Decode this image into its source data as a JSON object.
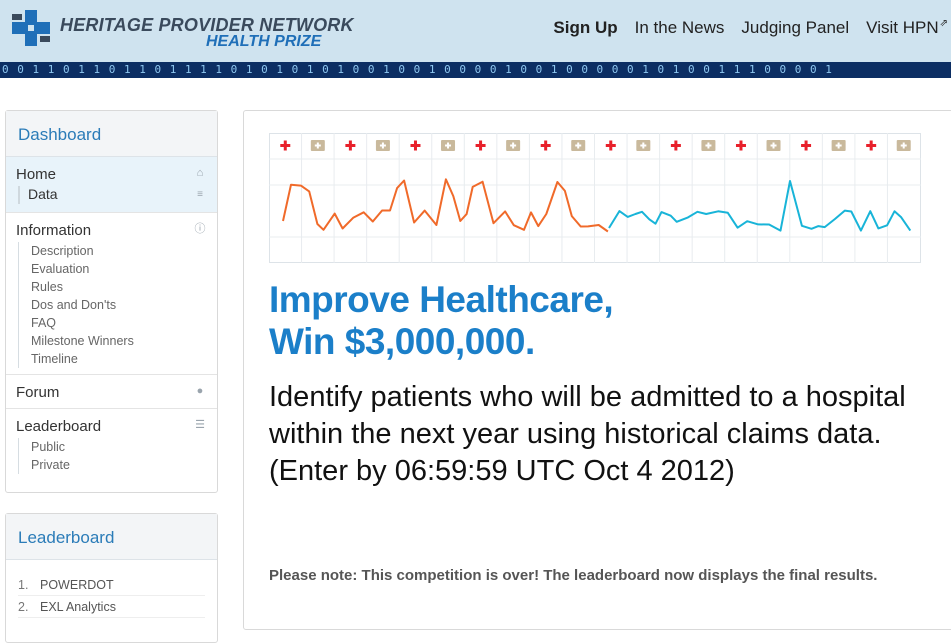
{
  "brand": {
    "line1": "HERITAGE PROVIDER NETWORK",
    "line2": "HEALTH PRIZE",
    "colors": {
      "navy": "#3a4a5c",
      "blue": "#1f6fb8",
      "header_bg": "#cfe3ef"
    }
  },
  "topnav": {
    "items": [
      {
        "label": "Sign Up"
      },
      {
        "label": "In the News"
      },
      {
        "label": "Judging Panel"
      },
      {
        "label": "Visit HPN"
      }
    ]
  },
  "binary_strip": "0 0 1  1 0   1 1 0  1  1 0   1 1  1 1 0  1 0   1 0   1 0  1 0 0  1 0 0 1  0 0 0  0  1 0 0  1 0 0  0 0 0 1  0 1 0 0  1 1  1 0 0 0 0 1",
  "sidebar": {
    "title": "Dashboard",
    "home": {
      "label": "Home",
      "icon": "home-icon"
    },
    "data": {
      "label": "Data",
      "icon": "database-icon"
    },
    "information": {
      "label": "Information",
      "icon": "info-icon",
      "links": [
        "Description",
        "Evaluation",
        "Rules",
        "Dos and Don'ts",
        "FAQ",
        "Milestone Winners",
        "Timeline"
      ]
    },
    "forum": {
      "label": "Forum",
      "icon": "comment-icon"
    },
    "leaderboard": {
      "label": "Leaderboard",
      "icon": "list-icon",
      "links": [
        "Public",
        "Private"
      ]
    }
  },
  "leaderboard_panel": {
    "title": "Leaderboard",
    "rows": [
      {
        "rank": "1.",
        "team": "POWERDOT"
      },
      {
        "rank": "2.",
        "team": "EXL Analytics"
      }
    ]
  },
  "main": {
    "headline_line1": "Improve Healthcare,",
    "headline_line2": "Win $3,000,000.",
    "description": "Identify patients who will be admitted to a hospital within the next year using historical claims data. (Enter by 06:59:59 UTC Oct 4 2012)",
    "note": "Please note: This competition is over! The leaderboard now displays the final results.",
    "colors": {
      "headline": "#1b7fc9",
      "ekg_orange": "#f06a2a",
      "ekg_blue": "#18b4d8",
      "cross_red": "#e8202a"
    }
  }
}
